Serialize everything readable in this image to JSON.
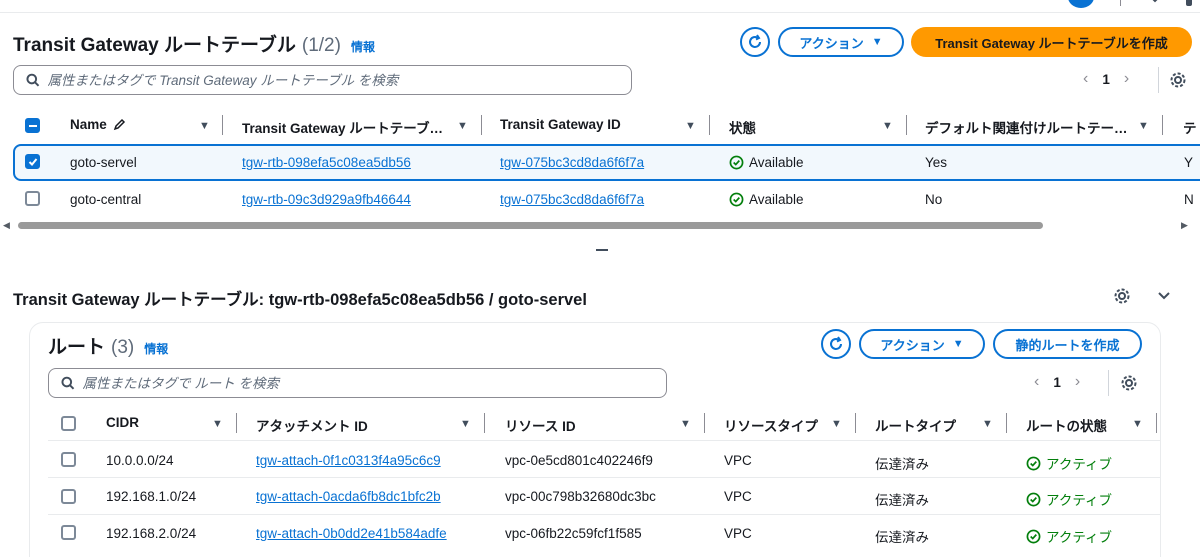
{
  "top_panel": {
    "title": "Transit Gateway ルートテーブル",
    "count": "(1/2)",
    "info": "情報",
    "actions_label": "アクション",
    "create_label": "Transit Gateway ルートテーブルを作成",
    "search_placeholder": "属性またはタグで Transit Gateway ルートテーブル を検索",
    "page": "1",
    "columns": {
      "name": "Name",
      "rtb": "Transit Gateway ルートテーブ…",
      "tgw": "Transit Gateway ID",
      "state": "状態",
      "default_assoc": "デフォルト関連付けルートテー…",
      "next": "テ"
    },
    "rows": [
      {
        "name": "goto-servel",
        "rtb": "tgw-rtb-098efa5c08ea5db56",
        "tgw": "tgw-075bc3cd8da6f6f7a",
        "state": "Available",
        "default_assoc": "Yes",
        "next": "Y",
        "selected": true
      },
      {
        "name": "goto-central",
        "rtb": "tgw-rtb-09c3d929a9fb46644",
        "tgw": "tgw-075bc3cd8da6f6f7a",
        "state": "Available",
        "default_assoc": "No",
        "next": "N",
        "selected": false
      }
    ]
  },
  "detail": {
    "title": "Transit Gateway ルートテーブル: tgw-rtb-098efa5c08ea5db56 / goto-servel"
  },
  "routes": {
    "title": "ルート",
    "count": "(3)",
    "info": "情報",
    "actions_label": "アクション",
    "create_label": "静的ルートを作成",
    "search_placeholder": "属性またはタグで ルート を検索",
    "page": "1",
    "columns": {
      "cidr": "CIDR",
      "attach": "アタッチメント ID",
      "resource": "リソース ID",
      "rtype": "リソースタイプ",
      "route_type": "ルートタイプ",
      "state": "ルートの状態"
    },
    "rows": [
      {
        "cidr": "10.0.0.0/24",
        "attach": "tgw-attach-0f1c0313f4a95c6c9",
        "resource": "vpc-0e5cd801c402246f9",
        "rtype": "VPC",
        "route_type": "伝達済み",
        "state": "アクティブ"
      },
      {
        "cidr": "192.168.1.0/24",
        "attach": "tgw-attach-0acda6fb8dc1bfc2b",
        "resource": "vpc-00c798b32680dc3bc",
        "rtype": "VPC",
        "route_type": "伝達済み",
        "state": "アクティブ"
      },
      {
        "cidr": "192.168.2.0/24",
        "attach": "tgw-attach-0b0dd2e41b584adfe",
        "resource": "vpc-06fb22c59fcf1f585",
        "rtype": "VPC",
        "route_type": "伝達済み",
        "state": "アクティブ"
      }
    ]
  },
  "colors": {
    "link": "#0972d3",
    "primary": "#ff9900",
    "success": "#037f0c"
  }
}
